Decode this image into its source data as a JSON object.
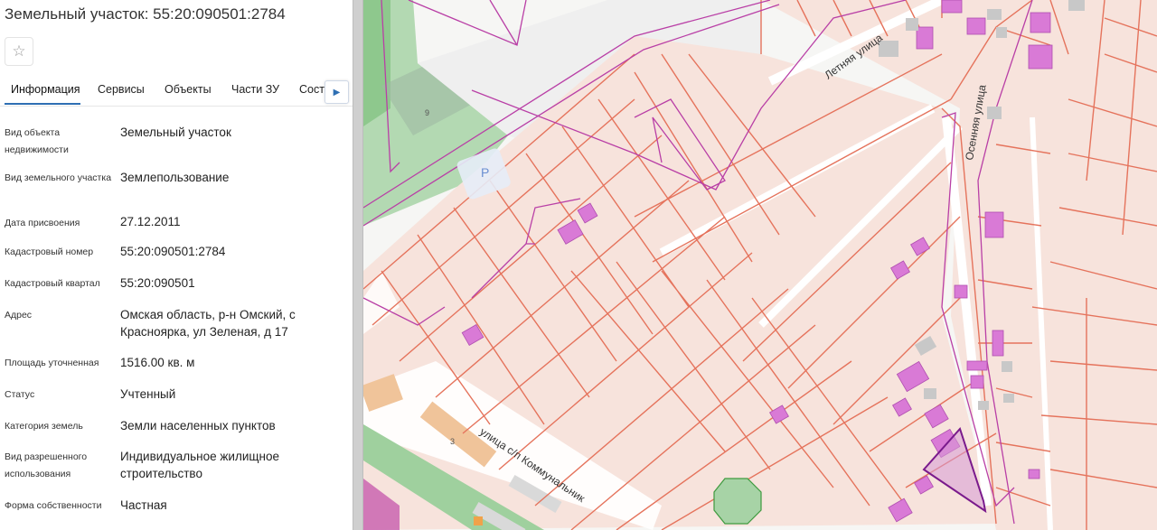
{
  "panel": {
    "title": "Земельный участок: 55:20:090501:2784",
    "favorite_icon": "star-outline-icon",
    "tabs": [
      {
        "label": "Информация",
        "active": true
      },
      {
        "label": "Сервисы",
        "active": false
      },
      {
        "label": "Объекты",
        "active": false
      },
      {
        "label": "Части ЗУ",
        "active": false
      },
      {
        "label": "Соста",
        "active": false
      }
    ],
    "tab_scroll_icon": "chevron-right-icon",
    "rows": [
      {
        "label": "Вид объекта недвижимости",
        "value": "Земельный участок"
      },
      {
        "label": "Вид земельного участка",
        "value": "Землепользование"
      },
      {
        "label": "Дата присвоения",
        "value": "27.12.2011"
      },
      {
        "label": "Кадастровый номер",
        "value": "55:20:090501:2784"
      },
      {
        "label": "Кадастровый квартал",
        "value": "55:20:090501"
      },
      {
        "label": "Адрес",
        "value": "Омская область, р-н Омский, с Красноярка, ул Зеленая, д 17"
      },
      {
        "label": "Площадь уточненная",
        "value": "1516.00 кв. м"
      },
      {
        "label": "Статус",
        "value": "Учтенный"
      },
      {
        "label": "Категория земель",
        "value": "Земли населенных пунктов"
      },
      {
        "label": "Вид разрешенного использования",
        "value": "Индивидуальное жилищное строительство"
      },
      {
        "label": "Форма собственности",
        "value": "Частная"
      }
    ]
  },
  "map": {
    "street_labels": {
      "letnyaya": "Летняя улица",
      "osennyaya": "Осенняя улица",
      "kommunalnik": "улица с/п Коммунальник"
    },
    "building_numbers": {
      "b9": "9",
      "b3": "3"
    },
    "parking_label": "P",
    "colors": {
      "parcel_fill": "#f7e3dc",
      "parcel_stroke": "#e5735c",
      "boundary": "#b93fa6",
      "building": "#d97ad6",
      "selected": "#7a1a8c",
      "green": "#a7d3a6",
      "road": "#ffffff"
    }
  }
}
